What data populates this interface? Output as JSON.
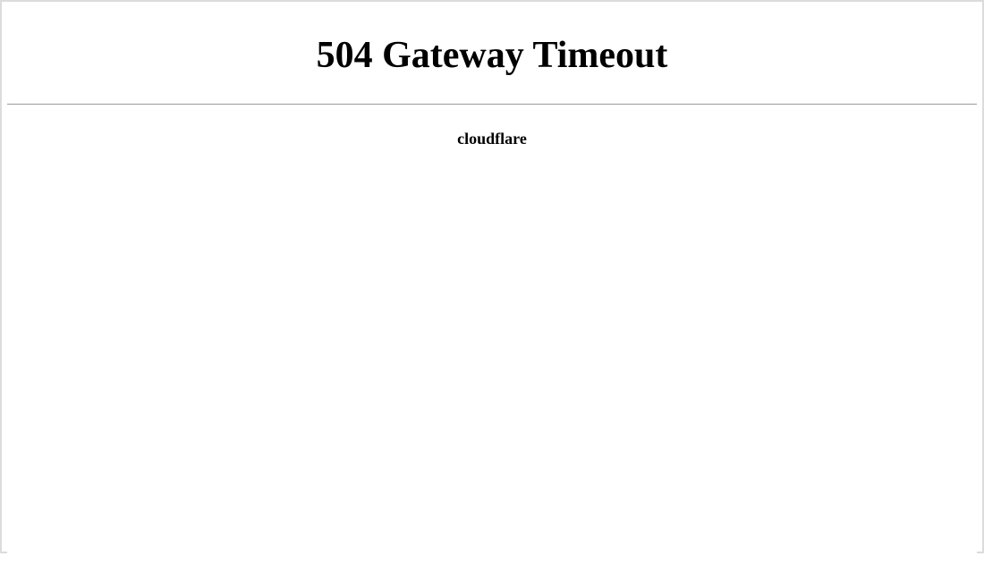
{
  "error": {
    "title": "504 Gateway Timeout",
    "provider": "cloudflare"
  }
}
